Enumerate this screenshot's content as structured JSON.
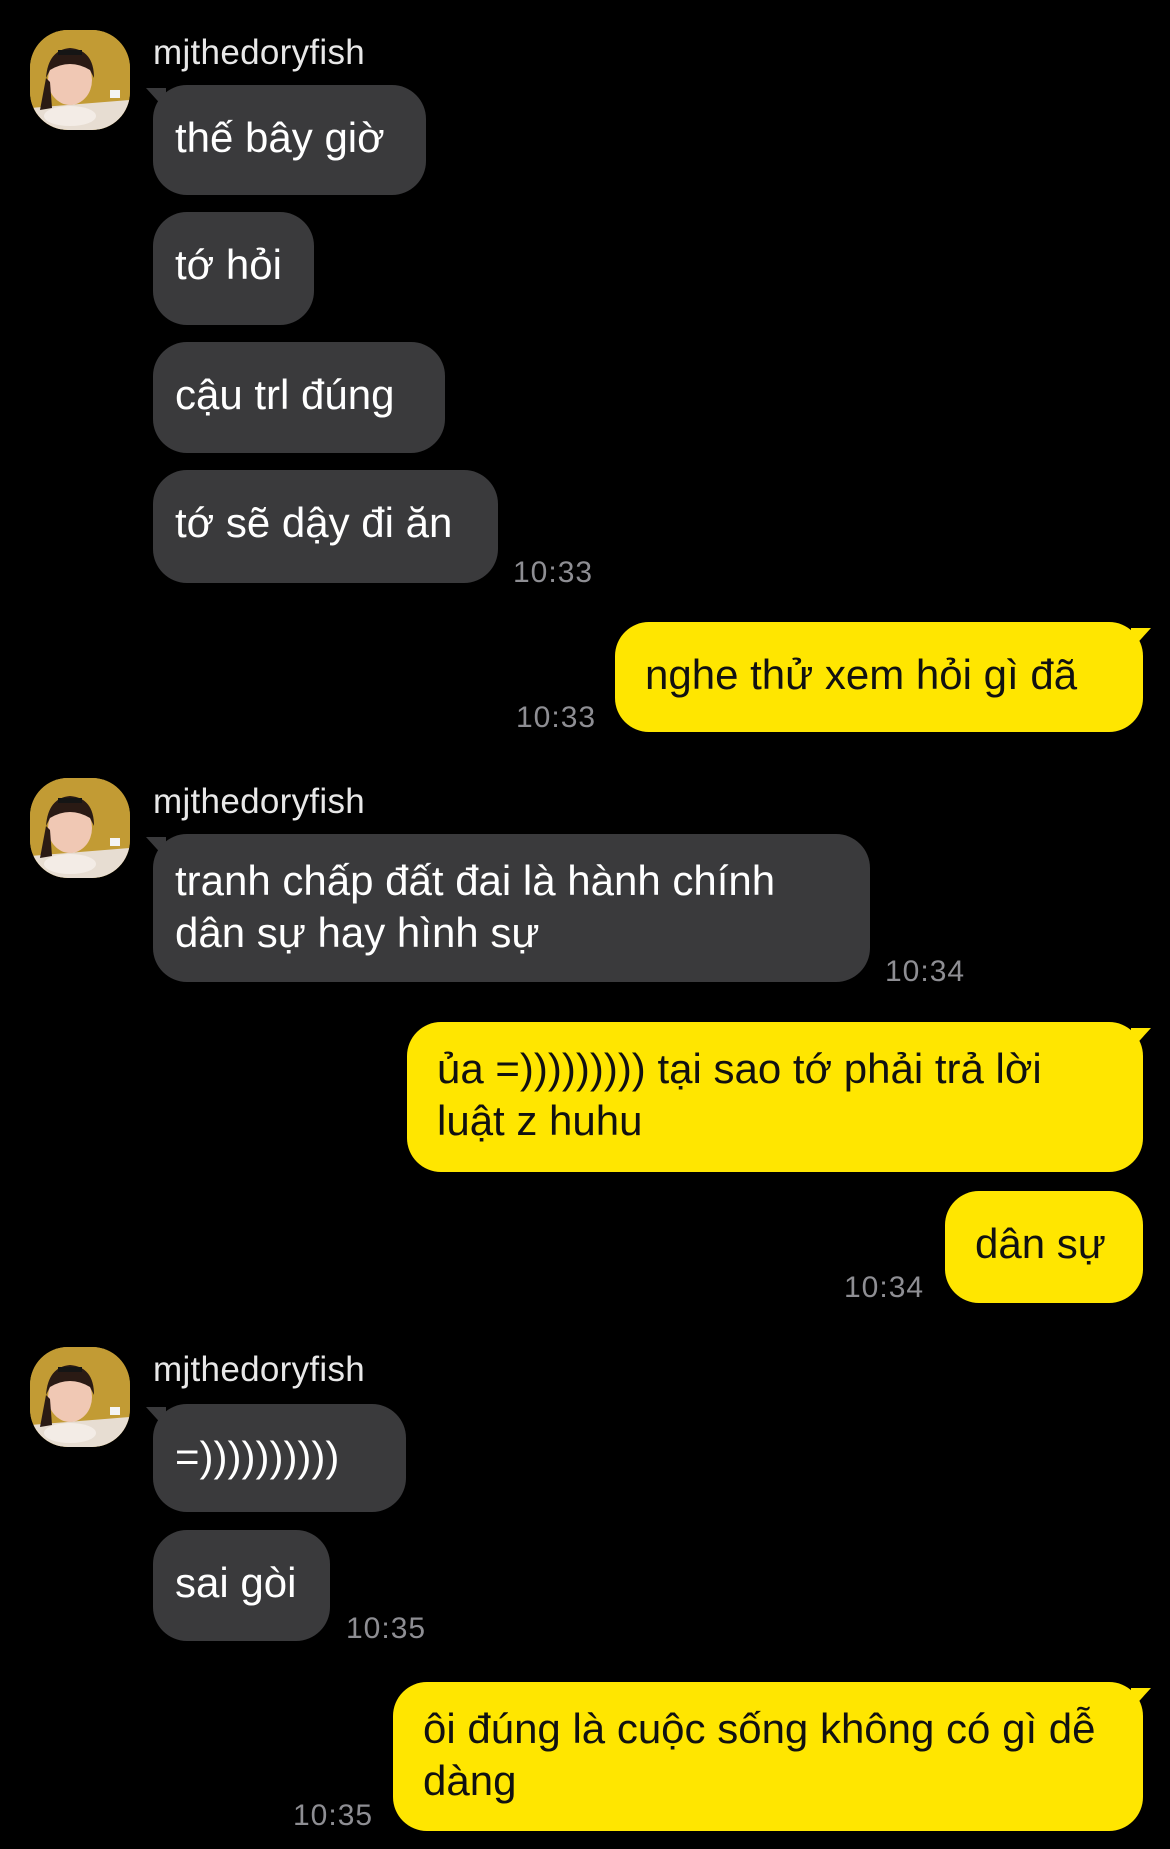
{
  "chat": {
    "sender_name": "mjthedoryfish",
    "groups": [
      {
        "name": "mjthedoryfish",
        "messages": [
          "thế bây giờ",
          "tớ hỏi",
          "cậu trl đúng",
          "tớ sẽ dậy đi ăn"
        ],
        "time": "10:33"
      },
      {
        "messages": [
          "nghe thử xem hỏi gì đã"
        ],
        "time": "10:33"
      },
      {
        "name": "mjthedoryfish",
        "messages": [
          "tranh chấp đất đai là hành chính dân sự hay hình sự"
        ],
        "time": "10:34"
      },
      {
        "messages": [
          "ủa =))))))))) tại sao tớ phải trả lời luật z huhu",
          "dân sự"
        ],
        "time": "10:34"
      },
      {
        "name": "mjthedoryfish",
        "messages": [
          "=))))))))))",
          "sai gòi"
        ],
        "time": "10:35"
      },
      {
        "messages": [
          "ôi đúng là cuộc sống không có gì dễ dàng"
        ],
        "time": "10:35"
      }
    ]
  },
  "colors": {
    "background": "#000000",
    "incoming_bubble": "#3a3a3c",
    "outgoing_bubble": "#ffe600",
    "timestamp": "#8e8e93"
  },
  "icons": [
    "avatar-photo"
  ]
}
